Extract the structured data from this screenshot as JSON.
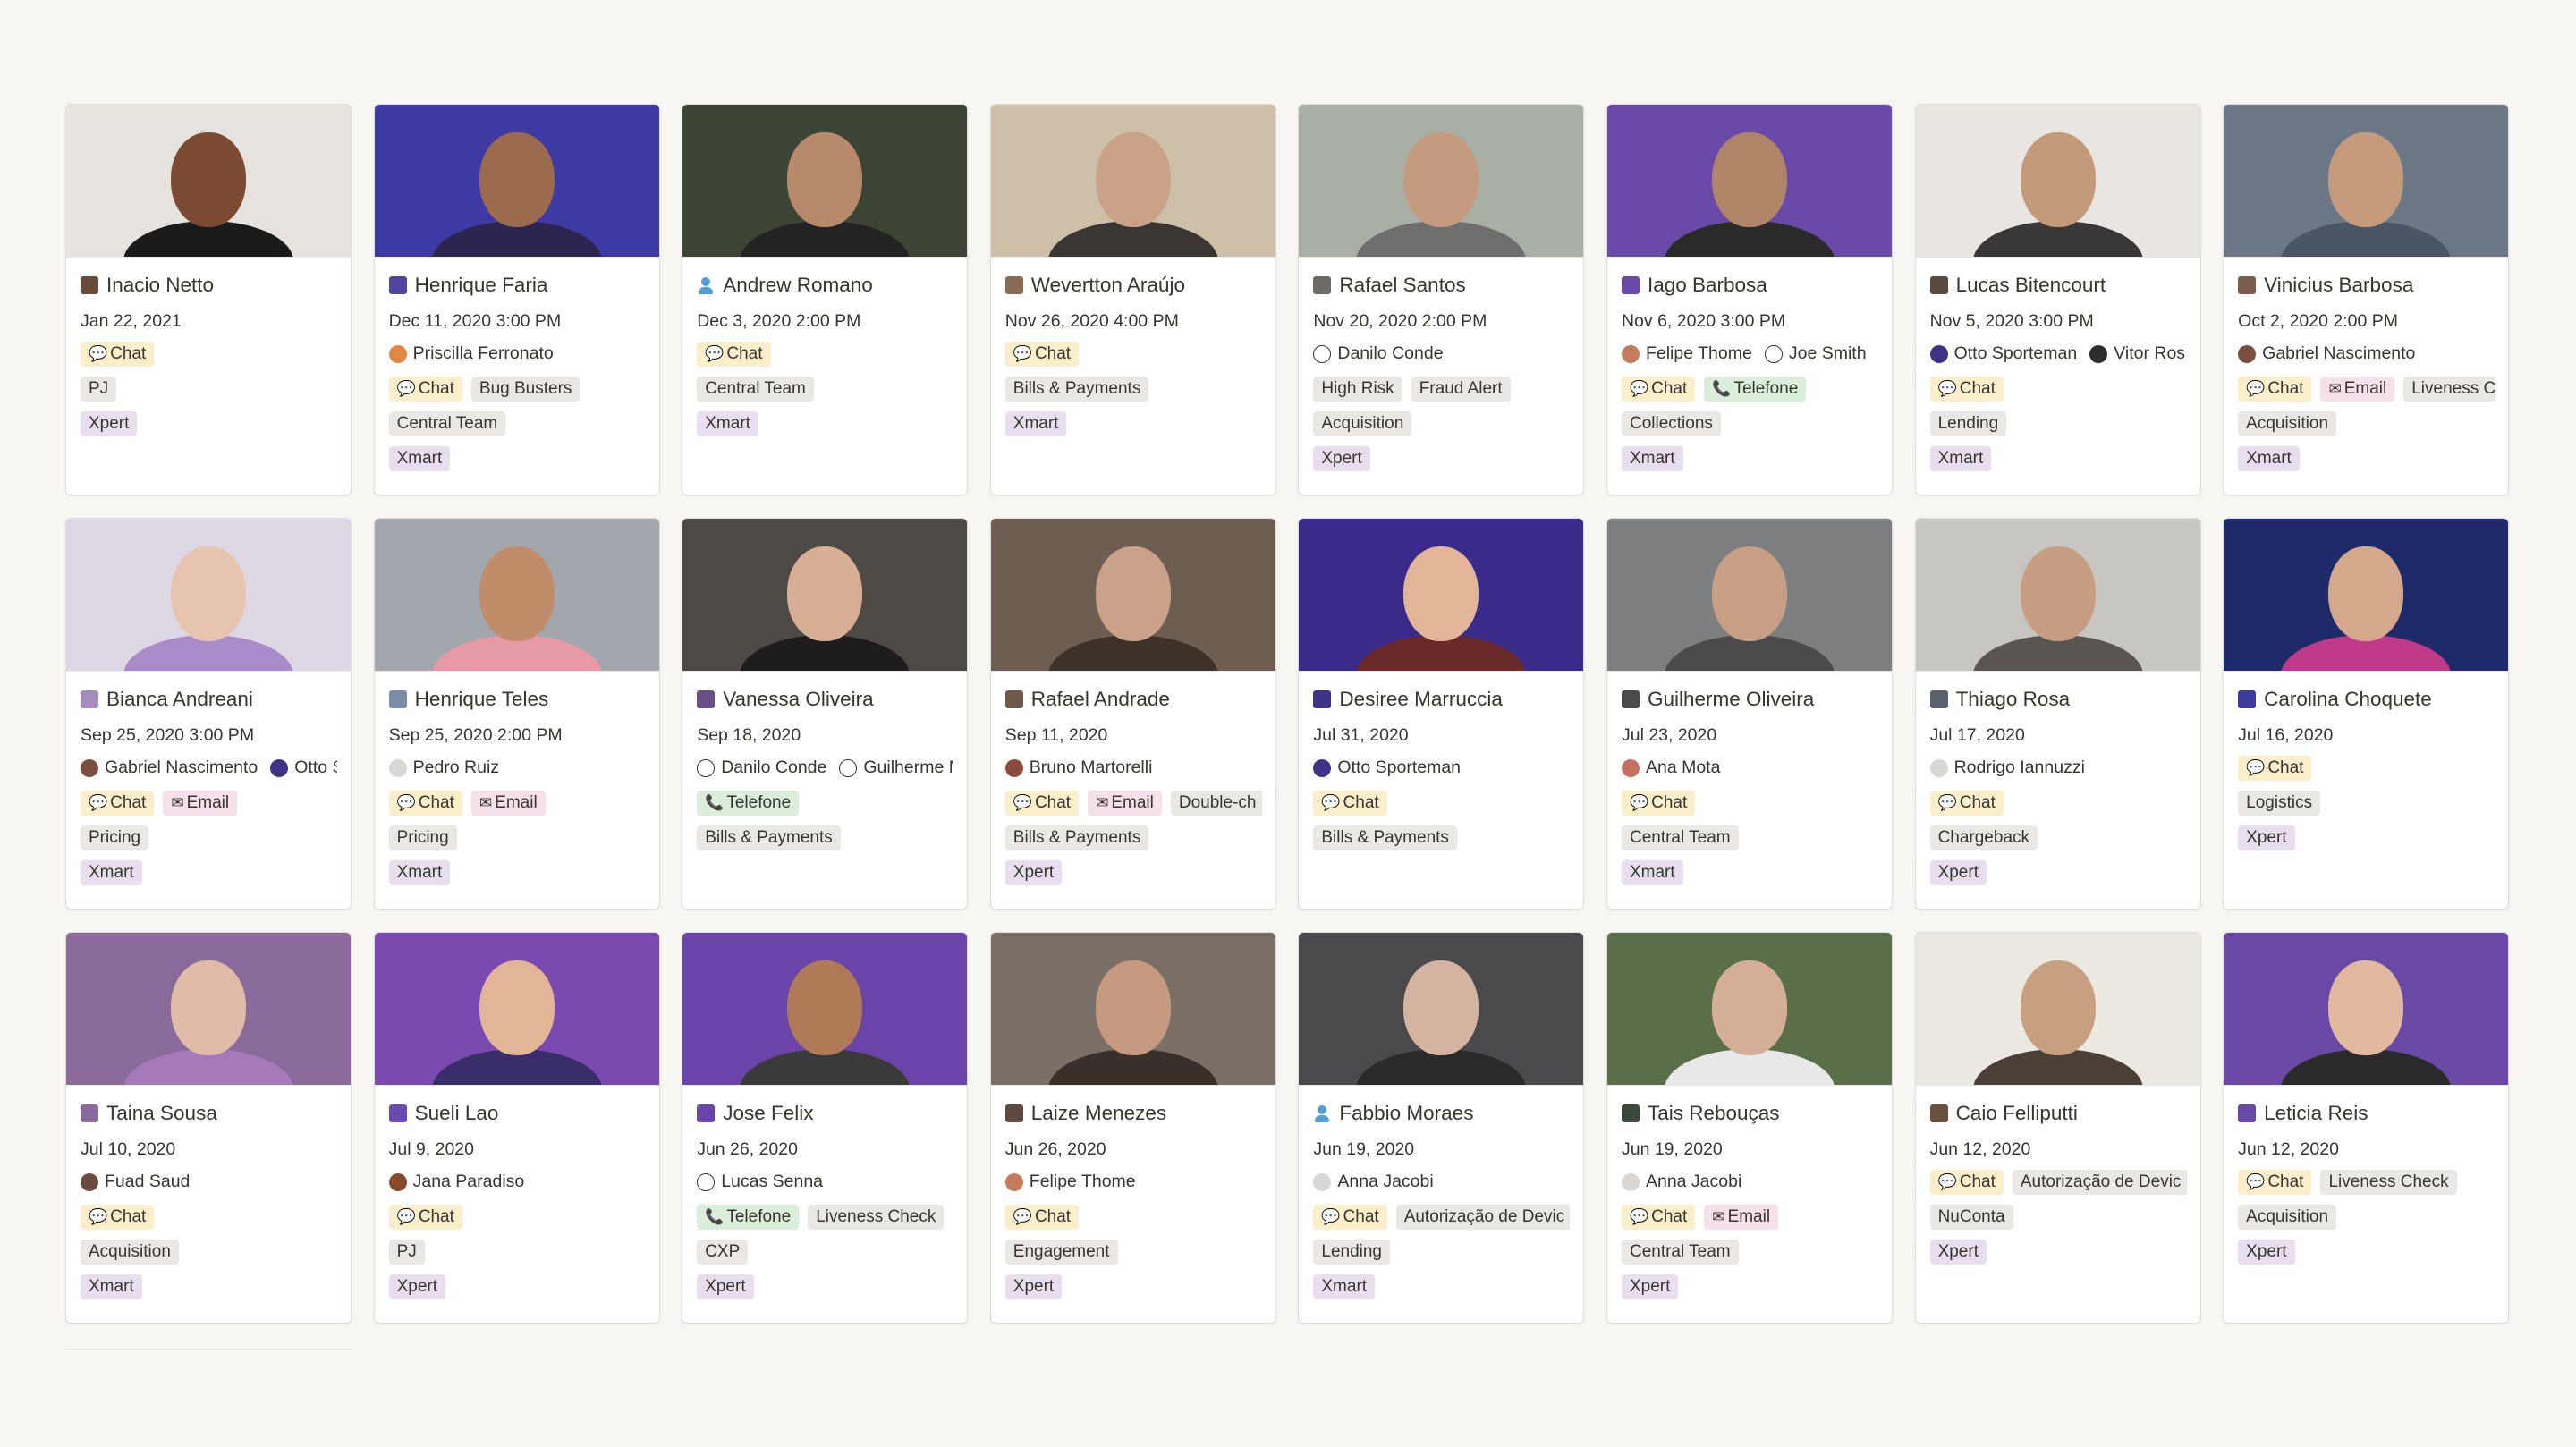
{
  "colors": {
    "background": "#f7f6f3",
    "card": "#ffffff",
    "tag_yellow": "#fbeecb",
    "tag_pink": "#f6e0ea",
    "tag_green": "#dbeddb",
    "tag_grey": "#e9e8e5",
    "tag_purple": "#e8deee"
  },
  "cards": [
    {
      "name": "Inacio Netto",
      "date": "Jan 22, 2021",
      "bg": "#e6e3df",
      "skin": "#7b4a33",
      "shirt": "#1b1a1a",
      "icon": "#6a4a3a",
      "people": [],
      "channels": [
        {
          "label": "Chat",
          "color": "yellow",
          "icon": "💬"
        }
      ],
      "team": "PJ",
      "team_color": "grey",
      "squad": "Xpert",
      "squad_color": "purple"
    },
    {
      "name": "Henrique Faria",
      "date": "Dec 11, 2020 3:00 PM",
      "bg": "#3e3aa3",
      "skin": "#9c6a4c",
      "shirt": "#2c2550",
      "icon": "#5046a0",
      "people": [
        {
          "name": "Priscilla Ferronato",
          "avatar": "#e28842"
        }
      ],
      "channels": [
        {
          "label": "Chat",
          "color": "yellow",
          "icon": "💬"
        },
        {
          "label": "Bug Busters",
          "color": "grey",
          "icon": ""
        }
      ],
      "team": "Central Team",
      "team_color": "grey",
      "squad": "Xmart",
      "squad_color": "purple"
    },
    {
      "name": "Andrew Romano",
      "date": "Dec 3, 2020 2:00 PM",
      "bg": "#3c4436",
      "skin": "#b88a6c",
      "shirt": "#232323",
      "icon": "person",
      "people": [],
      "channels": [
        {
          "label": "Chat",
          "color": "yellow",
          "icon": "💬"
        }
      ],
      "team": "Central Team",
      "team_color": "grey",
      "squad": "Xmart",
      "squad_color": "purple"
    },
    {
      "name": "Wevertton Araújo",
      "date": "Nov 26, 2020 4:00 PM",
      "bg": "#cdbfa8",
      "skin": "#c9a287",
      "shirt": "#3b3533",
      "icon": "#8b6b55",
      "people": [],
      "channels": [
        {
          "label": "Chat",
          "color": "yellow",
          "icon": "💬"
        }
      ],
      "team": "Bills & Payments",
      "team_color": "grey",
      "squad": "Xmart",
      "squad_color": "purple"
    },
    {
      "name": "Rafael Santos",
      "date": "Nov 20, 2020 2:00 PM",
      "bg": "#a8b0a6",
      "skin": "#c49b7f",
      "shirt": "#6e6e6c",
      "icon": "#6d6b65",
      "people": [
        {
          "name": "Danilo Conde",
          "avatar": "outline"
        }
      ],
      "channels": [
        {
          "label": "High Risk",
          "color": "grey",
          "icon": ""
        },
        {
          "label": "Fraud Alert",
          "color": "grey",
          "icon": ""
        }
      ],
      "team": "Acquisition",
      "team_color": "grey",
      "squad": "Xpert",
      "squad_color": "purple"
    },
    {
      "name": "Iago Barbosa",
      "date": "Nov 6, 2020 3:00 PM",
      "bg": "#6a4aa8",
      "skin": "#b08466",
      "shirt": "#2a2a2a",
      "icon": "#6a4aa8",
      "people": [
        {
          "name": "Felipe Thome",
          "avatar": "#c47c5c"
        },
        {
          "name": "Joe Smith",
          "avatar": "outline"
        }
      ],
      "channels": [
        {
          "label": "Chat",
          "color": "yellow",
          "icon": "💬"
        },
        {
          "label": "Telefone",
          "color": "green",
          "icon": "📞"
        }
      ],
      "team": "Collections",
      "team_color": "grey",
      "squad": "Xmart",
      "squad_color": "purple"
    },
    {
      "name": "Lucas Bitencourt",
      "date": "Nov 5, 2020 3:00 PM",
      "bg": "#e9e6e1",
      "skin": "#c39a7a",
      "shirt": "#3a3836",
      "icon": "#5a4a3e",
      "people": [
        {
          "name": "Otto Sporteman",
          "avatar": "#3f3388"
        },
        {
          "name": "Vitor Ros",
          "avatar": "#2d2d2d"
        }
      ],
      "channels": [
        {
          "label": "Chat",
          "color": "yellow",
          "icon": "💬"
        }
      ],
      "team": "Lending",
      "team_color": "grey",
      "squad": "Xmart",
      "squad_color": "purple"
    },
    {
      "name": "Vinicius Barbosa",
      "date": "Oct 2, 2020 2:00 PM",
      "bg": "#6c7888",
      "skin": "#c59b7c",
      "shirt": "#4a5666",
      "icon": "#7b5e4e",
      "people": [
        {
          "name": "Gabriel Nascimento",
          "avatar": "#7a4e3c"
        }
      ],
      "channels": [
        {
          "label": "Chat",
          "color": "yellow",
          "icon": "💬"
        },
        {
          "label": "Email",
          "color": "pink",
          "icon": "✉"
        },
        {
          "label": "Liveness C",
          "color": "grey",
          "icon": ""
        }
      ],
      "team": "Acquisition",
      "team_color": "grey",
      "squad": "Xmart",
      "squad_color": "purple"
    },
    {
      "name": "Bianca Andreani",
      "date": "Sep 25, 2020 3:00 PM",
      "bg": "#ddd8e3",
      "skin": "#e6c4b0",
      "shirt": "#a98bc9",
      "icon": "#a58dbc",
      "people": [
        {
          "name": "Gabriel Nascimento",
          "avatar": "#7a4e3c"
        },
        {
          "name": "Otto S",
          "avatar": "#3f3388"
        }
      ],
      "channels": [
        {
          "label": "Chat",
          "color": "yellow",
          "icon": "💬"
        },
        {
          "label": "Email",
          "color": "pink",
          "icon": "✉"
        }
      ],
      "team": "Pricing",
      "team_color": "grey",
      "squad": "Xmart",
      "squad_color": "purple"
    },
    {
      "name": "Henrique Teles",
      "date": "Sep 25, 2020 2:00 PM",
      "bg": "#a2a7ae",
      "skin": "#c08c6a",
      "shirt": "#e59aa6",
      "icon": "#7a8ca6",
      "people": [
        {
          "name": "Pedro Ruiz",
          "avatar": "grey"
        }
      ],
      "channels": [
        {
          "label": "Chat",
          "color": "yellow",
          "icon": "💬"
        },
        {
          "label": "Email",
          "color": "pink",
          "icon": "✉"
        }
      ],
      "team": "Pricing",
      "team_color": "grey",
      "squad": "Xmart",
      "squad_color": "purple"
    },
    {
      "name": "Vanessa Oliveira",
      "date": "Sep 18, 2020",
      "bg": "#4d4a46",
      "skin": "#d8ae94",
      "shirt": "#1e1d1c",
      "icon": "#6a4e86",
      "people": [
        {
          "name": "Danilo Conde",
          "avatar": "outline"
        },
        {
          "name": "Guilherme N",
          "avatar": "outline"
        }
      ],
      "channels": [
        {
          "label": "Telefone",
          "color": "green",
          "icon": "📞"
        }
      ],
      "team": "Bills & Payments",
      "team_color": "grey",
      "squad": "",
      "squad_color": "purple"
    },
    {
      "name": "Rafael Andrade",
      "date": "Sep 11, 2020",
      "bg": "#6e5e52",
      "skin": "#caa189",
      "shirt": "#3e3128",
      "icon": "#6e5a4a",
      "people": [
        {
          "name": "Bruno Martorelli",
          "avatar": "#8c4a3c"
        }
      ],
      "channels": [
        {
          "label": "Chat",
          "color": "yellow",
          "icon": "💬"
        },
        {
          "label": "Email",
          "color": "pink",
          "icon": "✉"
        },
        {
          "label": "Double-ch",
          "color": "grey",
          "icon": ""
        }
      ],
      "team": "Bills & Payments",
      "team_color": "grey",
      "squad": "Xpert",
      "squad_color": "purple"
    },
    {
      "name": "Desiree Marruccia",
      "date": "Jul 31, 2020",
      "bg": "#3a2a8a",
      "skin": "#e2b498",
      "shirt": "#6a2a2a",
      "icon": "#3e3488",
      "people": [
        {
          "name": "Otto Sporteman",
          "avatar": "#3f3388"
        }
      ],
      "channels": [
        {
          "label": "Chat",
          "color": "yellow",
          "icon": "💬"
        }
      ],
      "team": "Bills & Payments",
      "team_color": "grey",
      "squad": "",
      "squad_color": "purple"
    },
    {
      "name": "Guilherme Oliveira",
      "date": "Jul 23, 2020",
      "bg": "#7d7e80",
      "skin": "#c79f85",
      "shirt": "#4a4a4c",
      "icon": "#4a4a4c",
      "people": [
        {
          "name": "Ana Mota",
          "avatar": "#c47060"
        }
      ],
      "channels": [
        {
          "label": "Chat",
          "color": "yellow",
          "icon": "💬"
        }
      ],
      "team": "Central Team",
      "team_color": "grey",
      "squad": "Xmart",
      "squad_color": "purple"
    },
    {
      "name": "Thiago Rosa",
      "date": "Jul 17, 2020",
      "bg": "#c8c6c2",
      "skin": "#c89e82",
      "shirt": "#5a5550",
      "icon": "#5a6270",
      "people": [
        {
          "name": "Rodrigo Iannuzzi",
          "avatar": "grey"
        }
      ],
      "channels": [
        {
          "label": "Chat",
          "color": "yellow",
          "icon": "💬"
        }
      ],
      "team": "Chargeback",
      "team_color": "grey",
      "squad": "Xpert",
      "squad_color": "purple"
    },
    {
      "name": "Carolina Choquete",
      "date": "Jul 16, 2020",
      "bg": "#1e2a6a",
      "skin": "#d5a88c",
      "shirt": "#c03a8a",
      "icon": "#3e3c9a",
      "people": [],
      "channels": [
        {
          "label": "Chat",
          "color": "yellow",
          "icon": "💬"
        }
      ],
      "team": "Logistics",
      "team_color": "grey",
      "squad": "Xpert",
      "squad_color": "purple"
    },
    {
      "name": "Taina Sousa",
      "date": "Jul 10, 2020",
      "bg": "#8a6a9a",
      "skin": "#e0bca8",
      "shirt": "#a67ab8",
      "icon": "#8a6a9a",
      "people": [
        {
          "name": "Fuad Saud",
          "avatar": "#6a4a3a"
        }
      ],
      "channels": [
        {
          "label": "Chat",
          "color": "yellow",
          "icon": "💬"
        }
      ],
      "team": "Acquisition",
      "team_color": "grey",
      "squad": "Xmart",
      "squad_color": "purple"
    },
    {
      "name": "Sueli Lao",
      "date": "Jul 9, 2020",
      "bg": "#7a4ab0",
      "skin": "#e2b596",
      "shirt": "#3a2e6a",
      "icon": "#6a4ab0",
      "people": [
        {
          "name": "Jana Paradiso",
          "avatar": "#8a4a2a"
        }
      ],
      "channels": [
        {
          "label": "Chat",
          "color": "yellow",
          "icon": "💬"
        }
      ],
      "team": "PJ",
      "team_color": "grey",
      "squad": "Xpert",
      "squad_color": "purple"
    },
    {
      "name": "Jose Felix",
      "date": "Jun 26, 2020",
      "bg": "#6a44a8",
      "skin": "#b07a58",
      "shirt": "#3a3a3a",
      "icon": "#6a44a8",
      "people": [
        {
          "name": "Lucas Senna",
          "avatar": "outline"
        }
      ],
      "channels": [
        {
          "label": "Telefone",
          "color": "green",
          "icon": "📞"
        },
        {
          "label": "Liveness Check",
          "color": "grey",
          "icon": ""
        }
      ],
      "team": "CXP",
      "team_color": "grey",
      "squad": "Xpert",
      "squad_color": "purple"
    },
    {
      "name": "Laize Menezes",
      "date": "Jun 26, 2020",
      "bg": "#7a7068",
      "skin": "#c69a7e",
      "shirt": "#3a302a",
      "icon": "#5a4a40",
      "people": [
        {
          "name": "Felipe Thome",
          "avatar": "#c47c5c"
        }
      ],
      "channels": [
        {
          "label": "Chat",
          "color": "yellow",
          "icon": "💬"
        }
      ],
      "team": "Engagement",
      "team_color": "grey",
      "squad": "Xpert",
      "squad_color": "purple"
    },
    {
      "name": "Fabbio Moraes",
      "date": "Jun 19, 2020",
      "bg": "#4a4a4c",
      "skin": "#d4b4a0",
      "shirt": "#2a2a2a",
      "icon": "person",
      "people": [
        {
          "name": "Anna Jacobi",
          "avatar": "grey"
        }
      ],
      "channels": [
        {
          "label": "Chat",
          "color": "yellow",
          "icon": "💬"
        },
        {
          "label": "Autorização de Devic",
          "color": "grey",
          "icon": ""
        }
      ],
      "team": "Lending",
      "team_color": "grey",
      "squad": "Xmart",
      "squad_color": "purple"
    },
    {
      "name": "Tais Rebouças",
      "date": "Jun 19, 2020",
      "bg": "#5a6e4a",
      "skin": "#d4ae96",
      "shirt": "#e8e8e8",
      "icon": "#3a4a3a",
      "people": [
        {
          "name": "Anna Jacobi",
          "avatar": "grey"
        }
      ],
      "channels": [
        {
          "label": "Chat",
          "color": "yellow",
          "icon": "💬"
        },
        {
          "label": "Email",
          "color": "pink",
          "icon": "✉"
        }
      ],
      "team": "Central Team",
      "team_color": "grey",
      "squad": "Xpert",
      "squad_color": "purple"
    },
    {
      "name": "Caio Felliputti",
      "date": "Jun 12, 2020",
      "bg": "#ece8e2",
      "skin": "#c7a082",
      "shirt": "#4a4038",
      "icon": "#6a5040",
      "people": [],
      "channels": [
        {
          "label": "Chat",
          "color": "yellow",
          "icon": "💬"
        },
        {
          "label": "Autorização de Devic",
          "color": "grey",
          "icon": ""
        }
      ],
      "team": "NuConta",
      "team_color": "grey",
      "squad": "Xpert",
      "squad_color": "purple"
    },
    {
      "name": "Leticia Reis",
      "date": "Jun 12, 2020",
      "bg": "#6a48a6",
      "skin": "#e2b89e",
      "shirt": "#2a2a2a",
      "icon": "#6a48a6",
      "people": [],
      "channels": [
        {
          "label": "Chat",
          "color": "yellow",
          "icon": "💬"
        },
        {
          "label": "Liveness Check",
          "color": "grey",
          "icon": ""
        }
      ],
      "team": "Acquisition",
      "team_color": "grey",
      "squad": "Xpert",
      "squad_color": "purple"
    }
  ]
}
